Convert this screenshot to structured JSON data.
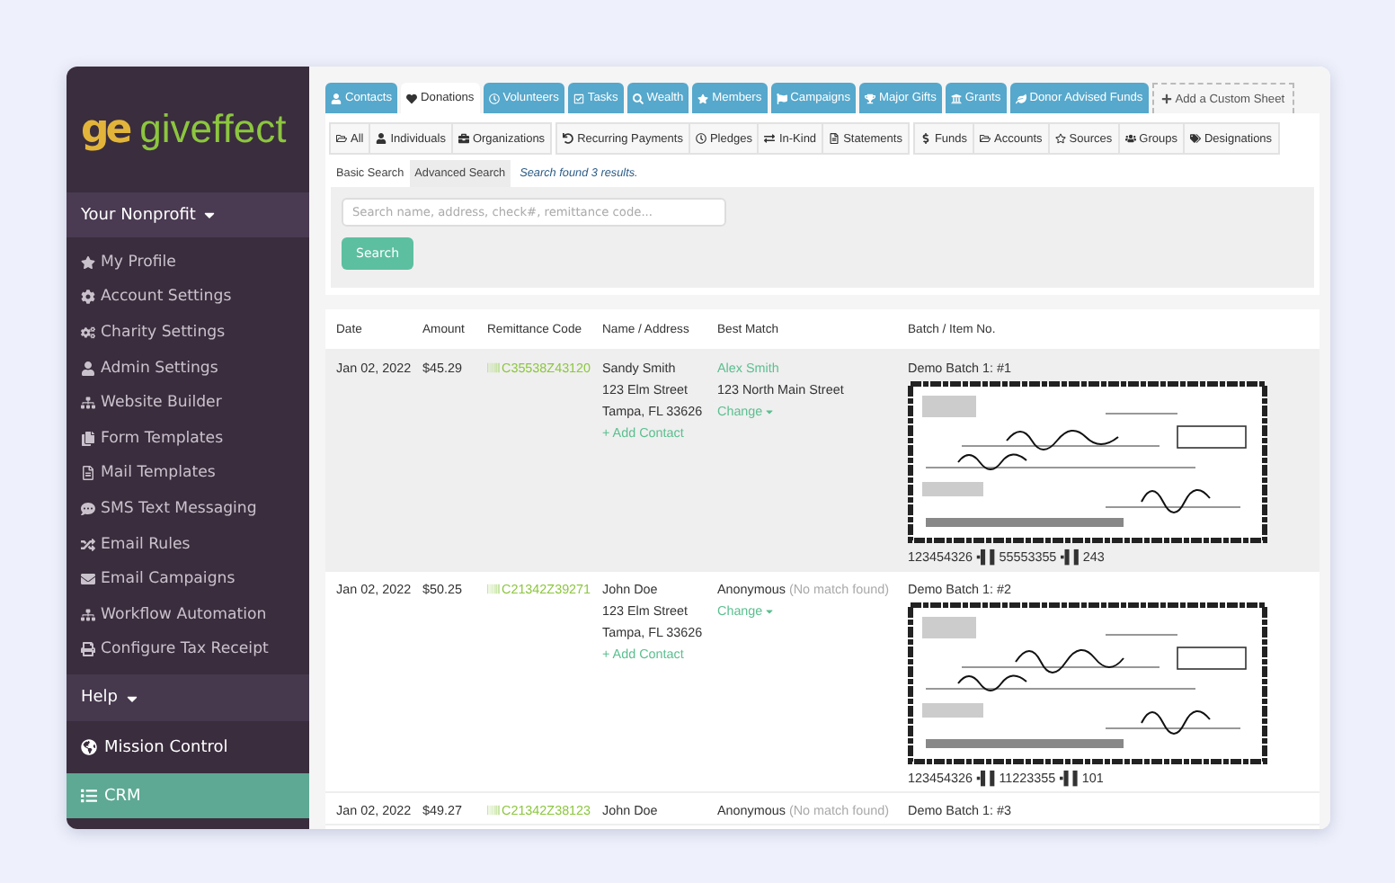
{
  "logo": {
    "mark": "ge",
    "name": "giveffect"
  },
  "sidebar": {
    "org_menu": "Your Nonprofit",
    "items": [
      {
        "label": "My Profile"
      },
      {
        "label": "Account Settings"
      },
      {
        "label": "Charity Settings"
      },
      {
        "label": "Admin Settings"
      },
      {
        "label": "Website Builder"
      },
      {
        "label": "Form Templates"
      },
      {
        "label": "Mail Templates"
      },
      {
        "label": "SMS Text Messaging"
      },
      {
        "label": "Email Rules"
      },
      {
        "label": "Email Campaigns"
      },
      {
        "label": "Workflow Automation"
      },
      {
        "label": "Configure Tax Receipt"
      }
    ],
    "help": "Help",
    "nav": [
      {
        "label": "Mission Control",
        "selected": false
      },
      {
        "label": "CRM",
        "selected": true
      }
    ]
  },
  "tabs": [
    {
      "label": "Contacts",
      "selected": false
    },
    {
      "label": "Donations",
      "selected": true
    },
    {
      "label": "Volunteers",
      "selected": false
    },
    {
      "label": "Tasks",
      "selected": false
    },
    {
      "label": "Wealth",
      "selected": false
    },
    {
      "label": "Members",
      "selected": false
    },
    {
      "label": "Campaigns",
      "selected": false
    },
    {
      "label": "Major Gifts",
      "selected": false
    },
    {
      "label": "Grants",
      "selected": false
    },
    {
      "label": "Donor Advised Funds",
      "selected": false
    }
  ],
  "add_sheet": "Add a Custom Sheet",
  "filter_groups": [
    [
      "All",
      "Individuals",
      "Organizations"
    ],
    [
      "Recurring Payments",
      "Pledges",
      "In-Kind",
      "Statements"
    ],
    [
      "Funds",
      "Accounts",
      "Sources",
      "Groups",
      "Designations"
    ]
  ],
  "search_tabs": [
    {
      "label": "Basic Search",
      "selected": false
    },
    {
      "label": "Advanced Search",
      "selected": true
    }
  ],
  "search_status": "Search found 3 results.",
  "search": {
    "placeholder": "Search name, address, check#, remittance code...",
    "button": "Search"
  },
  "table": {
    "columns": [
      "Date",
      "Amount",
      "Remittance Code",
      "Name / Address",
      "Best Match",
      "Batch / Item No."
    ],
    "rows": [
      {
        "selected": true,
        "date": "Jan 02, 2022",
        "amount": "$45.29",
        "code": "C35538Z43120",
        "name": "Sandy Smith",
        "address": [
          "123 Elm Street",
          "Tampa, FL 33626"
        ],
        "add_contact": "+ Add Contact",
        "match": {
          "kind": "contact",
          "name": "Alex Smith",
          "address": "123 North Main Street"
        },
        "change": "Change",
        "batch": "Demo Batch 1: #1",
        "scan": true,
        "micr": "123454326 ▪▌▌55553355 ▪▌▌243"
      },
      {
        "selected": false,
        "date": "Jan 02, 2022",
        "amount": "$50.25",
        "code": "C21342Z39271",
        "name": "John Doe",
        "address": [
          "123 Elm Street",
          "Tampa, FL 33626"
        ],
        "add_contact": "+ Add Contact",
        "match": {
          "kind": "none",
          "name": "Anonymous",
          "note": "(No match found)"
        },
        "change": "Change",
        "batch": "Demo Batch 1: #2",
        "scan": true,
        "micr": "123454326 ▪▌▌11223355 ▪▌▌101"
      },
      {
        "selected": false,
        "date": "Jan 02, 2022",
        "amount": "$49.27",
        "code": "C21342Z38123",
        "name": "John Doe",
        "match": {
          "kind": "none",
          "name": "Anonymous",
          "note": "(No match found)"
        },
        "batch": "Demo Batch 1: #3"
      }
    ]
  }
}
